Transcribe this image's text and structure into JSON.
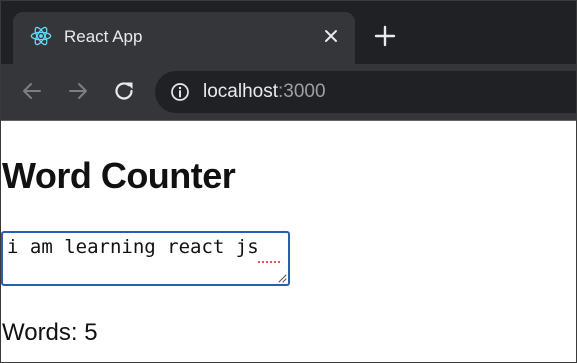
{
  "browser": {
    "tab": {
      "title": "React App",
      "favicon": "react-logo-icon"
    },
    "address_bar": {
      "host": "localhost",
      "port": ":3000"
    },
    "icons": {
      "back": "arrow-left-icon",
      "forward": "arrow-right-icon",
      "reload": "reload-icon",
      "site_info": "info-icon",
      "close_tab": "close-icon",
      "new_tab": "plus-icon"
    },
    "colors": {
      "tabstrip": "#202124",
      "active_tab": "#35363a",
      "react_blue": "#61dafb"
    }
  },
  "page": {
    "heading": "Word Counter",
    "textarea": {
      "value": "i am learning react js",
      "focus_border": "#2b5db3"
    },
    "word_count": "Words: 5"
  }
}
